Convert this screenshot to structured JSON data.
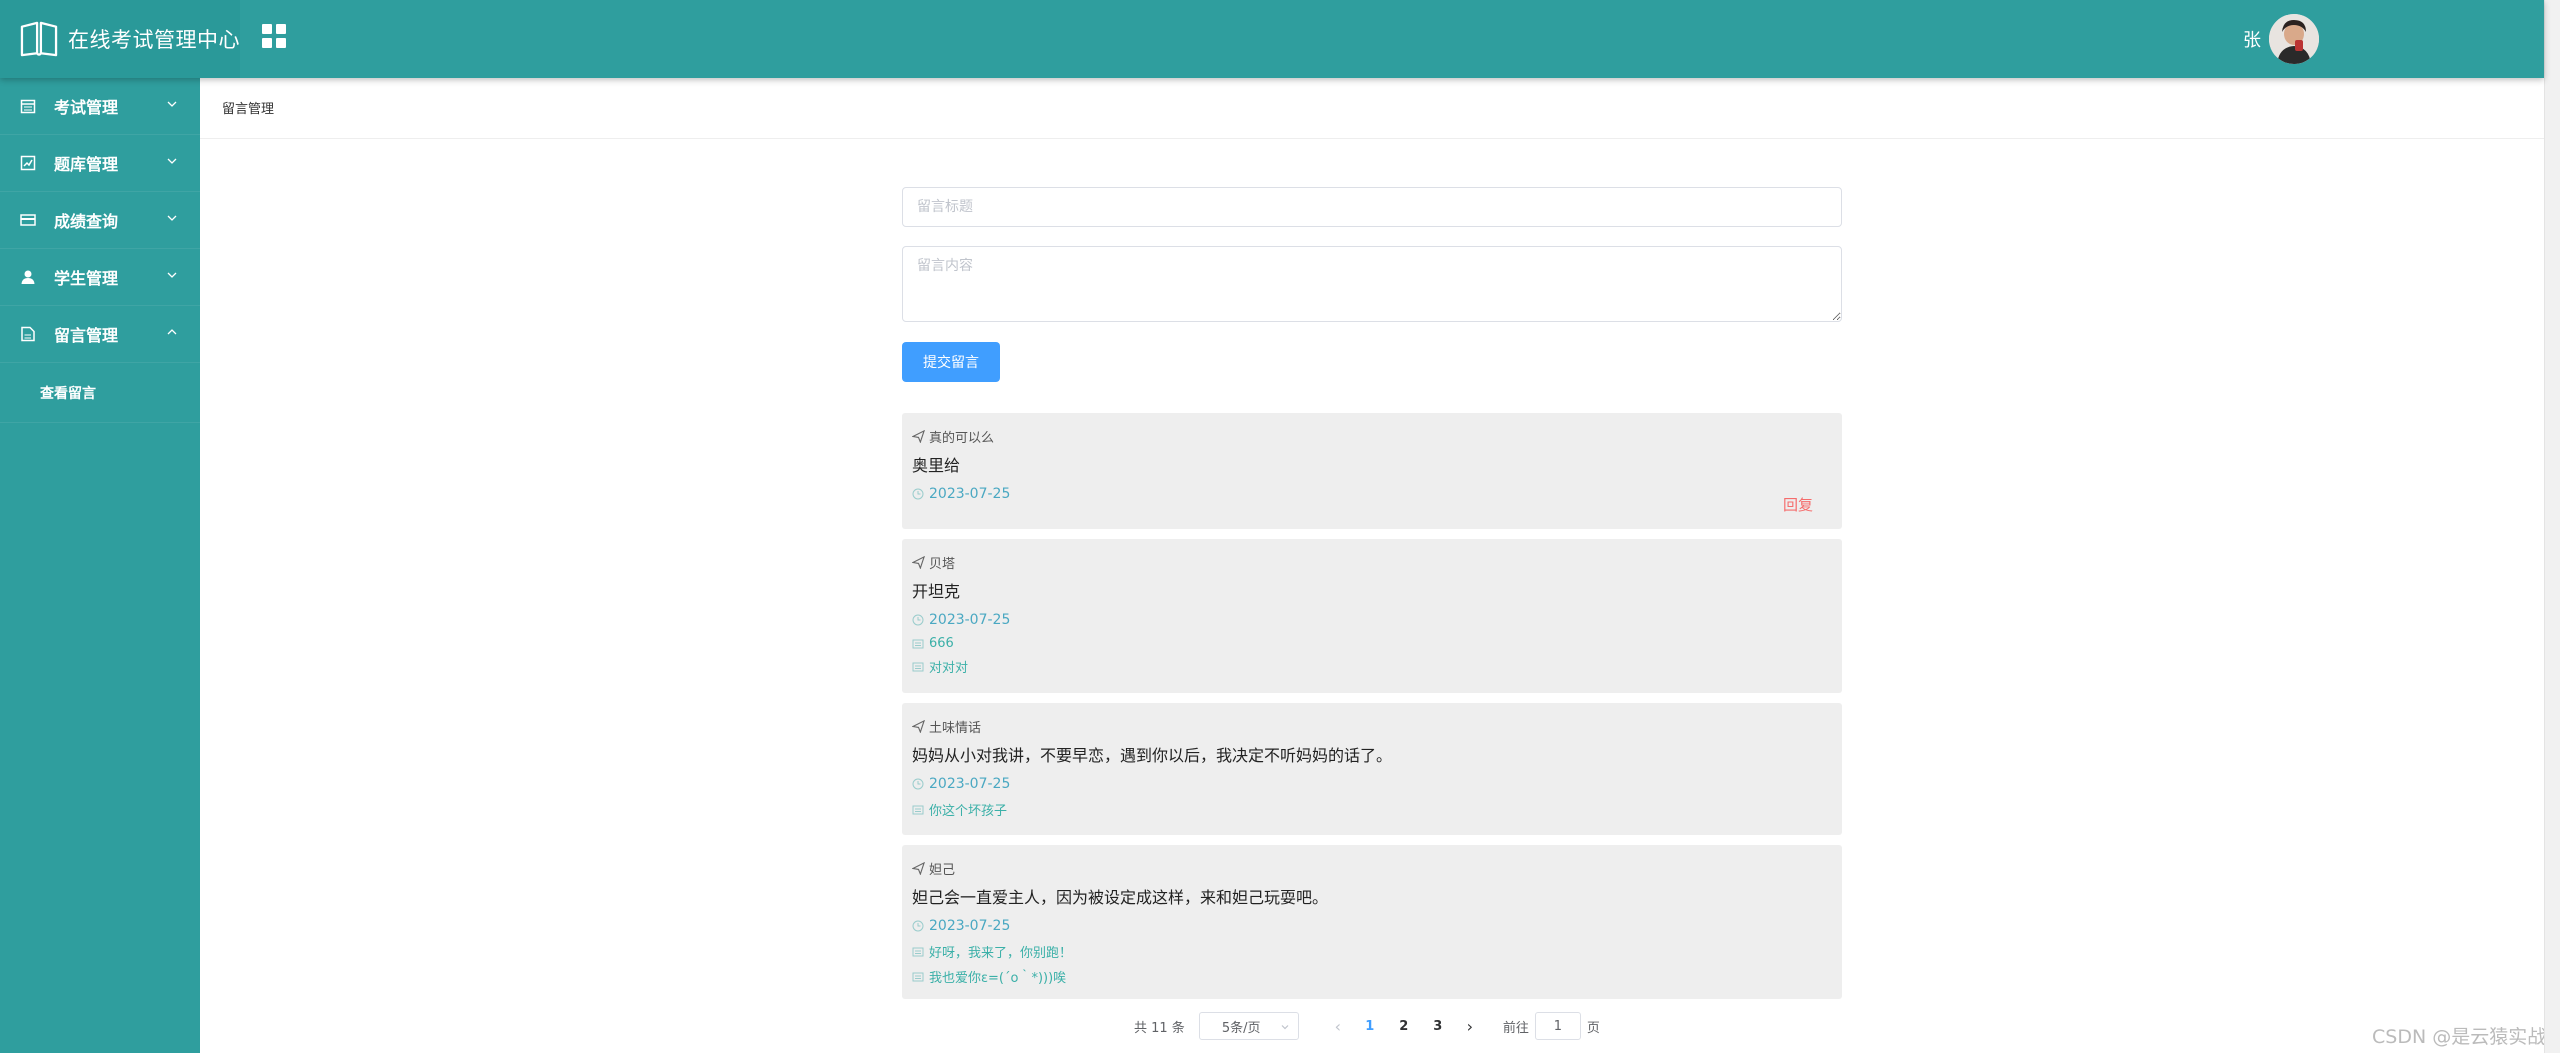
{
  "app": {
    "title": "在线考试管理中心",
    "theme_color": "#2f9e9e"
  },
  "header": {
    "user_name": "张",
    "avatar_icon": "user-avatar"
  },
  "sidebar": {
    "items": [
      {
        "label": "考试管理",
        "icon": "calendar-icon",
        "expanded": false
      },
      {
        "label": "题库管理",
        "icon": "edit-doc-icon",
        "expanded": false
      },
      {
        "label": "成绩查询",
        "icon": "card-icon",
        "expanded": false
      },
      {
        "label": "学生管理",
        "icon": "person-icon",
        "expanded": false
      },
      {
        "label": "留言管理",
        "icon": "doc-icon",
        "expanded": true
      }
    ],
    "subitems": [
      {
        "label": "查看留言"
      }
    ]
  },
  "breadcrumb": {
    "current": "留言管理"
  },
  "form": {
    "title_placeholder": "留言标题",
    "content_placeholder": "留言内容",
    "submit_label": "提交留言"
  },
  "messages": [
    {
      "author": "真的可以么",
      "content": "奥里给",
      "date": "2023-07-25",
      "replies": [],
      "reply_label": "回复"
    },
    {
      "author": "贝塔",
      "content": "开坦克",
      "date": "2023-07-25",
      "replies": [
        "666",
        "对对对"
      ]
    },
    {
      "author": "土味情话",
      "content": "妈妈从小对我讲，不要早恋，遇到你以后，我决定不听妈妈的话了。",
      "date": "2023-07-25",
      "replies": [
        "你这个坏孩子"
      ]
    },
    {
      "author": "妲己",
      "content": "妲己会一直爱主人，因为被设定成这样，来和妲己玩耍吧。",
      "date": "2023-07-25",
      "replies": [
        "好呀，我来了，你别跑！",
        "我也爱你ε=(´ο｀*)))唉"
      ]
    }
  ],
  "pagination": {
    "total_label": "共 11 条",
    "page_size_label": "5条/页",
    "pages": [
      "1",
      "2",
      "3"
    ],
    "current_page": "1",
    "goto_prefix": "前往",
    "goto_value": "1",
    "goto_suffix": "页"
  },
  "watermark": "CSDN @是云猿实战"
}
